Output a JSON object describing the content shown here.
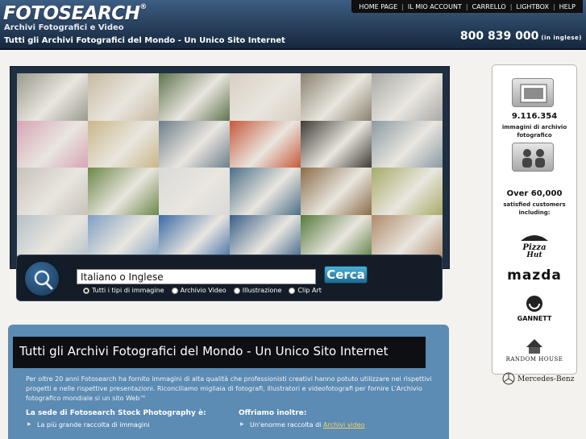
{
  "header": {
    "logo": "FOTOSEARCH",
    "logo_mark": "®",
    "tagline": "Archivi Fotografici e Video",
    "subline": "Tutti gli Archivi Fotografici del Mondo - Un Unico Sito Internet",
    "nav": [
      "HOME PAGE",
      "IL MIO ACCOUNT",
      "CARRELLO",
      "LIGHTBOX",
      "HELP"
    ],
    "phone": "800 839 000",
    "phone_note": "(in inglese)"
  },
  "mosaic": {
    "tiles": [
      "money-hand-photo",
      "beach-rope-photo",
      "deer-photo",
      "family-photo",
      "group-people-photo",
      "business-people-photo",
      "pagoda-photo",
      "cooking-photo",
      "mountain-photo",
      "flowers-photo",
      "audience-photo",
      "temple-photo",
      "elderly-woman-photo",
      "tractor-photo",
      "woman-lying-photo",
      "rowing-photo",
      "classroom-photo",
      "students-photo",
      "elephant-photo",
      "sky-photo",
      "glass-building-photo",
      "sea-photo",
      "tennis-photo",
      "smiling-woman-photo"
    ],
    "colors": [
      "#9a9a8e",
      "#c8b9a2",
      "#5f7450",
      "#d8cfc3",
      "#8a8270",
      "#a9a9a7",
      "#d7a4b6",
      "#c9b78a",
      "#6e7e8c",
      "#c7593a",
      "#3e3a34",
      "#8b9aa3",
      "#c7c2ba",
      "#6c8748",
      "#dadada",
      "#4c6f88",
      "#8a6c48",
      "#a7ab67",
      "#b5c0c6",
      "#7f9fc3",
      "#3a6aa5",
      "#395f88",
      "#557a3b",
      "#b08a6a"
    ]
  },
  "search": {
    "value": "Italiano o Inglese",
    "button": "Cerca",
    "options": [
      "Tutti i tipi di immagine",
      "Archivio Video",
      "Illustrazione",
      "Clip Art"
    ],
    "selected": 0
  },
  "panel": {
    "stat1_num": "9.116.354",
    "stat1_label1": "immagini di archivio",
    "stat1_label2": "fotografico",
    "stat2_num": "Over 60,000",
    "stat2_label1": "satisfied customers",
    "stat2_label2": "including:",
    "brands": [
      "Pizza Hut",
      "mazda",
      "GANNETT",
      "RANDOM HOUSE",
      "Mercedes-Benz"
    ]
  },
  "content": {
    "title": "Tutti gli Archivi Fotografici del Mondo - Un Unico Sito Internet",
    "paragraph": "Per oltre 20 anni Fotosearch ha fornito immagini di alta qualità che professionisti creativi hanno potuto utilizzare nei rispettivi progetti e nelle rispettive presentazioni. Riconciliamo migliaia di fotografi, illustratori e videofotografi per fornire L'Archivio fotografico mondiale si un sito Web™",
    "left_title": "La sede di Fotosearch Stock Photography è:",
    "left_items": [
      "La più grande raccolta di immagini"
    ],
    "right_title": "Offriamo inoltre:",
    "right_item_prefix": "Un'enorme raccolta di",
    "right_item_link": "Archivi video"
  }
}
